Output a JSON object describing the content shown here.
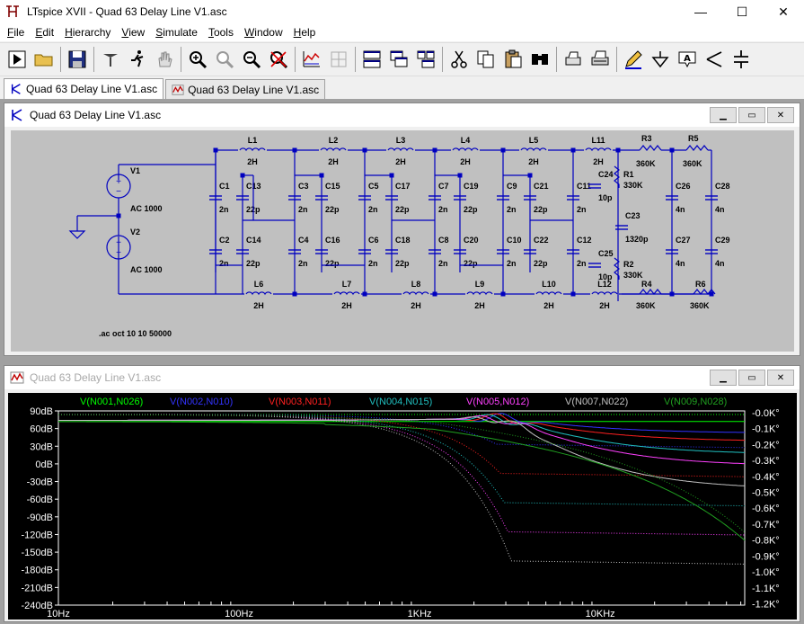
{
  "window": {
    "title": "LTspice XVII - Quad 63 Delay Line V1.asc",
    "minimize": "—",
    "maximize": "☐",
    "close": "✕"
  },
  "menu": [
    {
      "label": "File",
      "u": "F",
      "rest": "ile"
    },
    {
      "label": "Edit",
      "u": "E",
      "rest": "dit"
    },
    {
      "label": "Hierarchy",
      "u": "H",
      "rest": "ierarchy"
    },
    {
      "label": "View",
      "u": "V",
      "rest": "iew"
    },
    {
      "label": "Simulate",
      "u": "S",
      "rest": "imulate"
    },
    {
      "label": "Tools",
      "u": "T",
      "rest": "ools"
    },
    {
      "label": "Window",
      "u": "W",
      "rest": "indow"
    },
    {
      "label": "Help",
      "u": "H",
      "rest": "elp"
    }
  ],
  "toolbar": [
    "run-icon",
    "open-folder-icon",
    "sep",
    "save-icon",
    "sep",
    "control-panel-icon",
    "run-man-icon",
    "pan-hand-icon",
    "sep",
    "zoom-in-icon",
    "zoom-area-icon",
    "zoom-out-icon",
    "zoom-cancel-icon",
    "sep",
    "autorange-icon",
    "grid-icon",
    "sep",
    "tile-horizontal-icon",
    "cascade-icon",
    "tile-icon",
    "sep",
    "cut-icon",
    "copy-icon",
    "paste-icon",
    "find-icon",
    "sep",
    "print-preview-icon",
    "print-icon",
    "sep",
    "pencil-icon",
    "ground-icon",
    "label-net-icon",
    "resistor-icon",
    "capacitor-icon"
  ],
  "tabs": [
    {
      "label": "Quad 63 Delay Line V1.asc",
      "active": true,
      "icon": "schematic-icon"
    },
    {
      "label": "Quad 63 Delay Line V1.asc",
      "active": false,
      "icon": "waveform-icon"
    }
  ],
  "schematic": {
    "title": "Quad 63 Delay Line V1.asc",
    "sources": [
      {
        "name": "V1",
        "value": "AC 1000"
      },
      {
        "name": "V2",
        "value": "AC 1000"
      }
    ],
    "top_inductors": [
      "L1",
      "L2",
      "L3",
      "L4",
      "L5",
      "L11"
    ],
    "bottom_inductors": [
      "L6",
      "L7",
      "L8",
      "L9",
      "L10",
      "L12"
    ],
    "inductor_value": "2H",
    "caps_top": [
      [
        "C1",
        "2n"
      ],
      [
        "C13",
        "22p"
      ],
      [
        "C3",
        "2n"
      ],
      [
        "C15",
        "22p"
      ],
      [
        "C5",
        "2n"
      ],
      [
        "C17",
        "22p"
      ],
      [
        "C7",
        "2n"
      ],
      [
        "C19",
        "22p"
      ],
      [
        "C9",
        "2n"
      ],
      [
        "C21",
        "22p"
      ],
      [
        "C11",
        "2n"
      ]
    ],
    "caps_bottom": [
      [
        "C2",
        "2n"
      ],
      [
        "C14",
        "22p"
      ],
      [
        "C4",
        "2n"
      ],
      [
        "C16",
        "22p"
      ],
      [
        "C6",
        "2n"
      ],
      [
        "C18",
        "22p"
      ],
      [
        "C8",
        "2n"
      ],
      [
        "C20",
        "22p"
      ],
      [
        "C10",
        "2n"
      ],
      [
        "C22",
        "22p"
      ],
      [
        "C12",
        "2n"
      ]
    ],
    "other": {
      "C24": "10p",
      "C25": "10p",
      "C23": "1320p",
      "R1": "330K",
      "R2": "330K",
      "R3": "360K",
      "R4": "360K",
      "R5": "360K",
      "R6": "360K",
      "C26": "4n",
      "C27": "4n",
      "C28": "4n",
      "C29": "4n"
    },
    "directive": ".ac oct 10 10 50000"
  },
  "waveform": {
    "title": "Quad 63 Delay Line V1.asc",
    "traces": [
      {
        "name": "V(N001,N026)",
        "color": "#00ff00"
      },
      {
        "name": "V(N002,N010)",
        "color": "#3333ff"
      },
      {
        "name": "V(N003,N011)",
        "color": "#ff2020"
      },
      {
        "name": "V(N004,N015)",
        "color": "#20c0c0"
      },
      {
        "name": "V(N005,N012)",
        "color": "#ff40ff"
      },
      {
        "name": "V(N007,N022)",
        "color": "#c0c0c0"
      },
      {
        "name": "V(N009,N028)",
        "color": "#20a020"
      }
    ],
    "left_ticks": [
      "90dB",
      "60dB",
      "30dB",
      "0dB",
      "-30dB",
      "-60dB",
      "-90dB",
      "-120dB",
      "-150dB",
      "-180dB",
      "-210dB",
      "-240dB"
    ],
    "right_ticks": [
      "-0.0K°",
      "-0.1K°",
      "-0.2K°",
      "-0.3K°",
      "-0.4K°",
      "-0.5K°",
      "-0.6K°",
      "-0.7K°",
      "-0.8K°",
      "-0.9K°",
      "-1.0K°",
      "-1.1K°",
      "-1.2K°"
    ],
    "x_ticks": [
      "10Hz",
      "100Hz",
      "1KHz",
      "10KHz"
    ]
  }
}
